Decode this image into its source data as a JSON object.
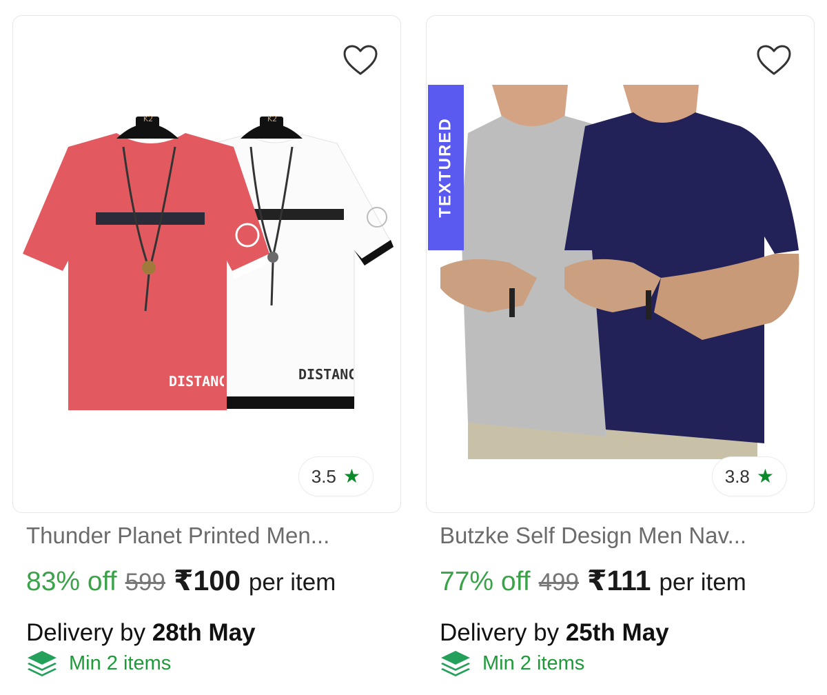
{
  "colors": {
    "discount_green": "#3aa34a",
    "star_green": "#0b8a2a",
    "texture_badge": "#5a5af0"
  },
  "icons": {
    "wishlist": "heart-outline-icon",
    "rating": "star-icon",
    "min_items": "layers-icon"
  },
  "products": [
    {
      "title": "Thunder Planet Printed Men...",
      "rating": "3.5",
      "discount": "83% off",
      "mrp": "599",
      "price": "₹100",
      "per": "per item",
      "delivery_prefix": "Delivery by",
      "delivery_date": "28th May",
      "min_items": "Min 2 items",
      "print_left": "DISTANCE",
      "print_right": "DISTANCE",
      "hanger": "K2"
    },
    {
      "title": "Butzke Self Design Men Nav...",
      "rating": "3.8",
      "discount": "77% off",
      "mrp": "499",
      "price": "₹111",
      "per": "per item",
      "delivery_prefix": "Delivery by",
      "delivery_date": "25th May",
      "min_items": "Min 2 items",
      "badge": "TEXTURED"
    }
  ]
}
